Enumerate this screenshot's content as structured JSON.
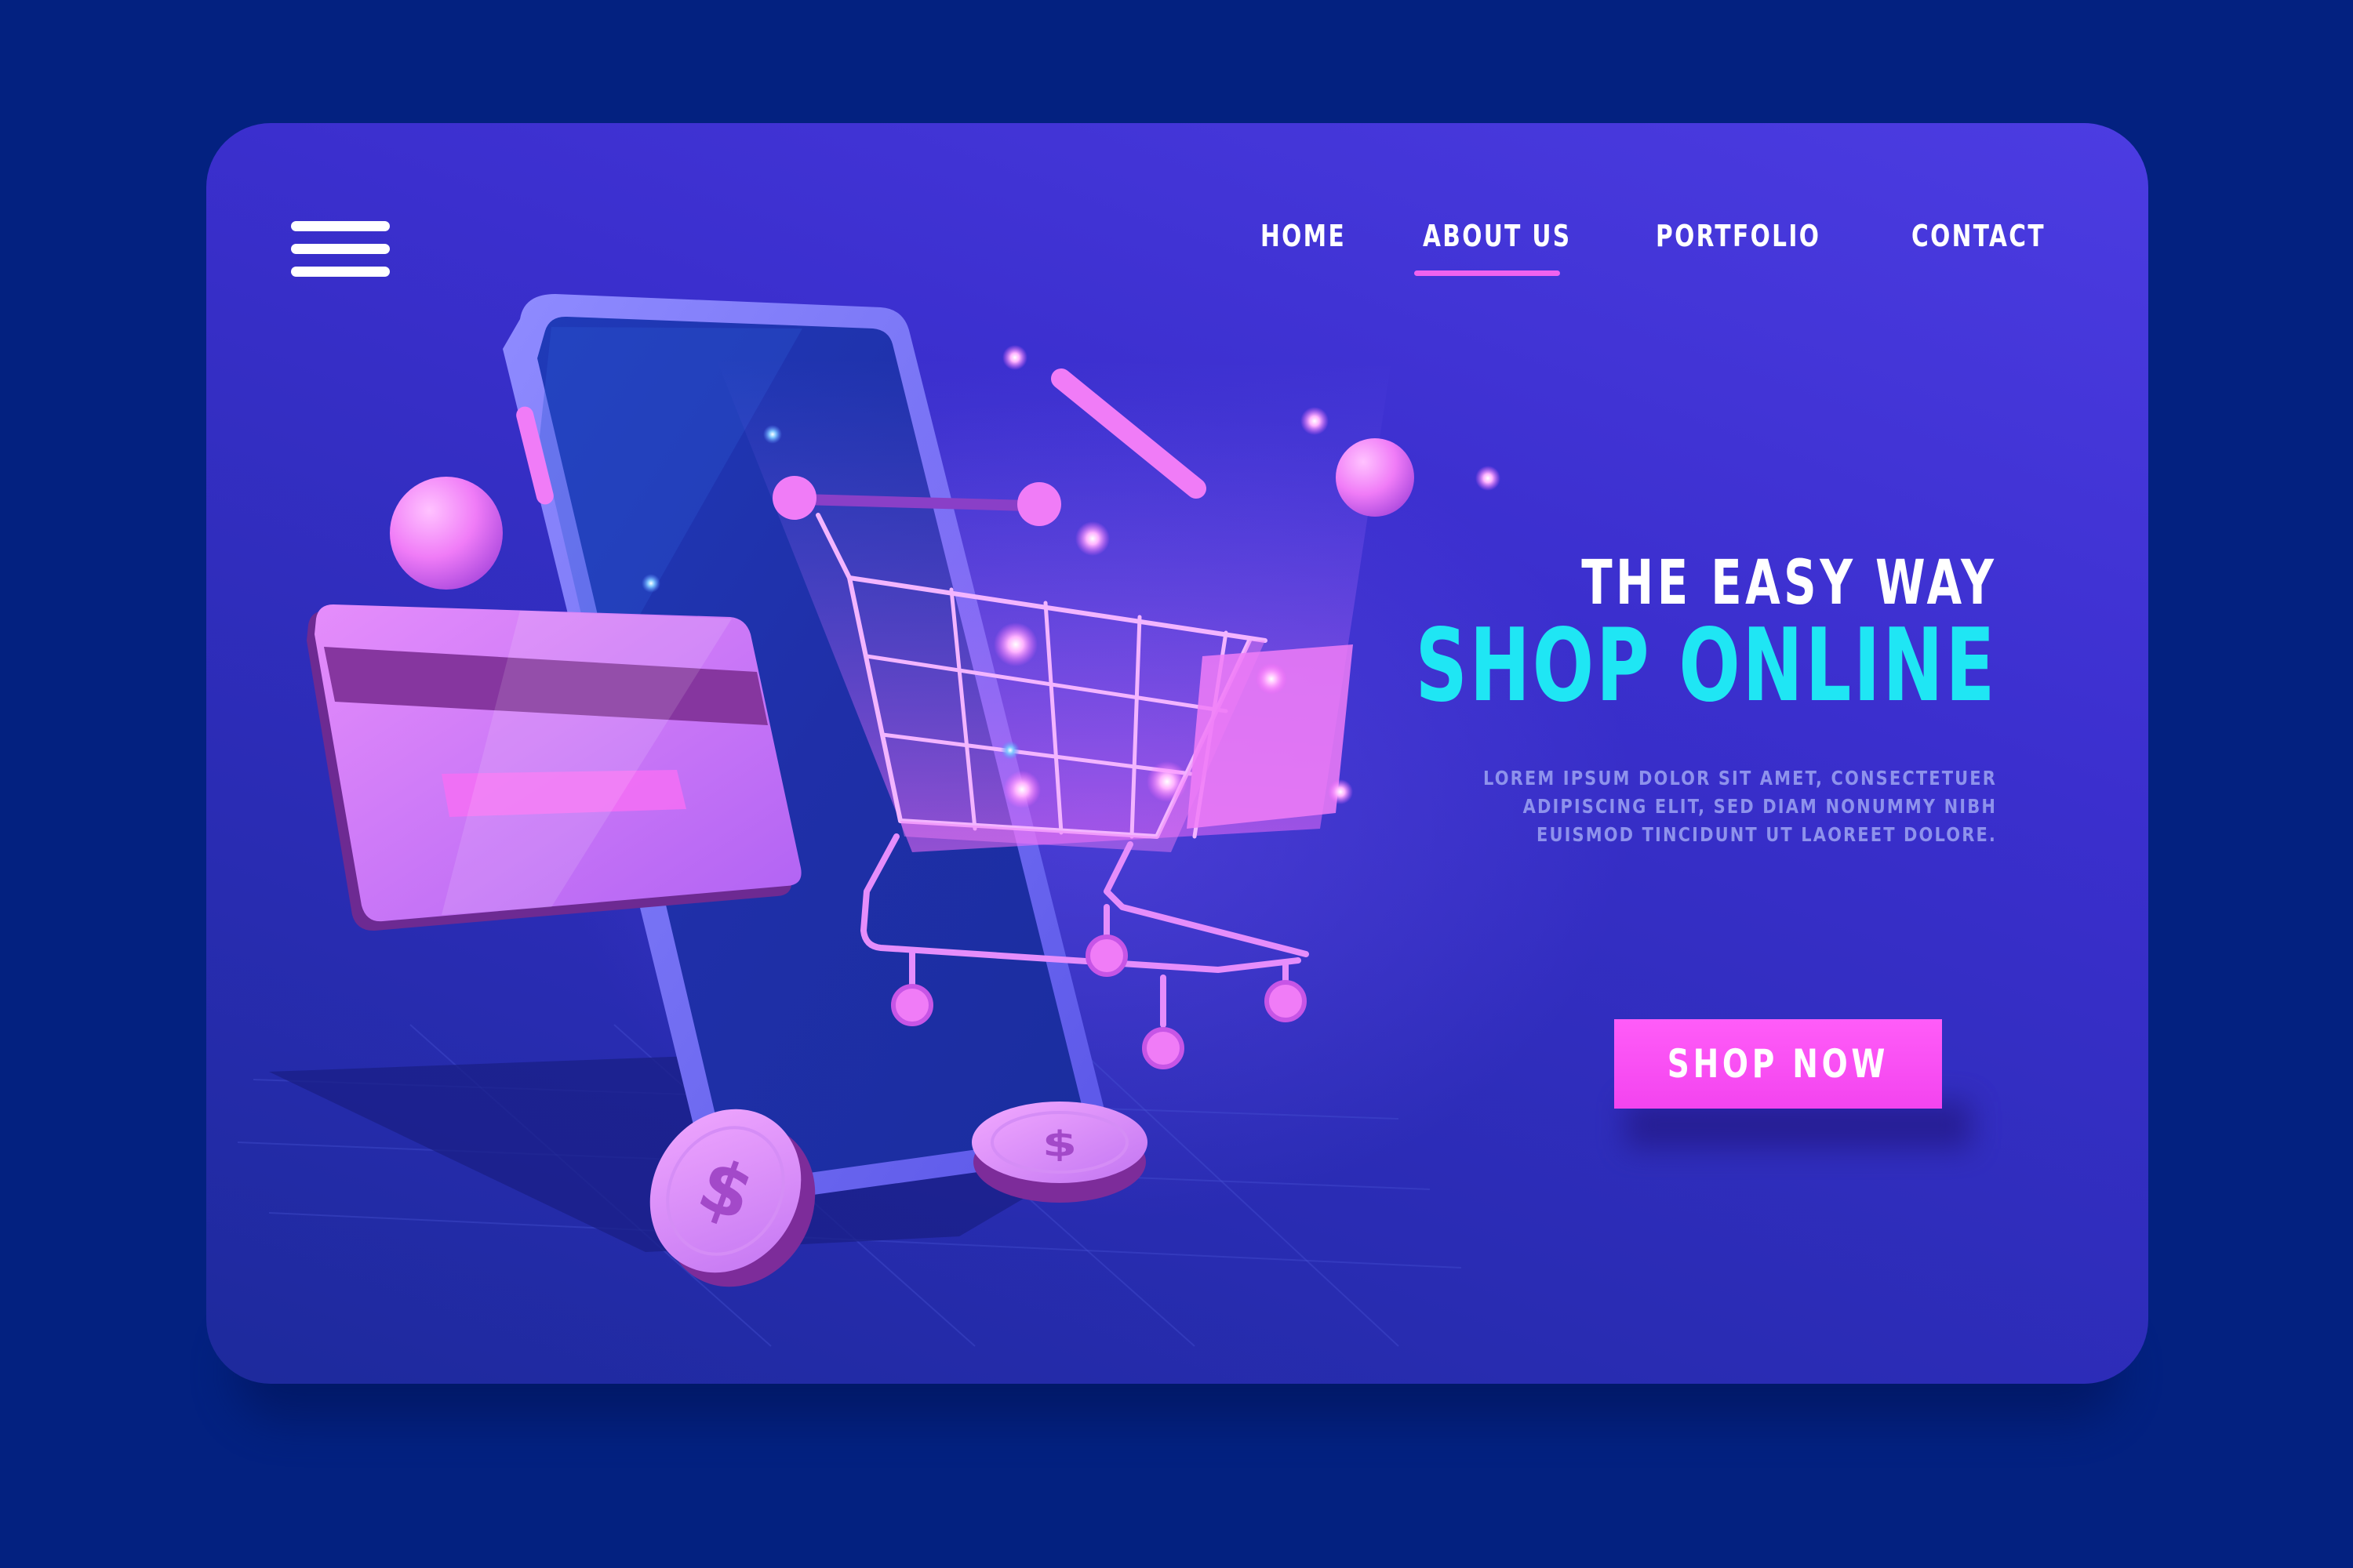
{
  "nav": {
    "items": [
      {
        "label": "HOME"
      },
      {
        "label": "ABOUT US",
        "active": true
      },
      {
        "label": "PORTFOLIO"
      },
      {
        "label": "CONTACT"
      }
    ]
  },
  "hero": {
    "subtitle": "THE EASY WAY",
    "title": "SHOP ONLINE",
    "description": "LOREM IPSUM DOLOR SIT AMET, CONSECTETUER ADIPISCING ELIT, SED DIAM NONUMMY NIBH EUISMOD TINCIDUNT UT LAOREET DOLORE.",
    "cta_label": "SHOP NOW"
  },
  "colors": {
    "page_background": "#032180",
    "accent_pink": "#f344ef",
    "accent_cyan": "#1fe6f4",
    "panel_top": "#4c3ce2",
    "panel_bottom": "#1d2a9c"
  },
  "icons": {
    "menu": "hamburger-menu-icon",
    "coin": "dollar-coin-icon"
  }
}
